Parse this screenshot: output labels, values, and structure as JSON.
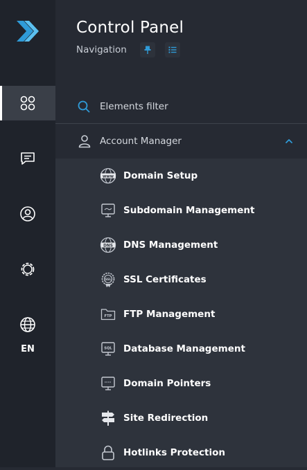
{
  "header": {
    "title": "Control Panel",
    "subtitle": "Navigation"
  },
  "rail": {
    "items": [
      {
        "name": "dashboard",
        "icon": "grid-circles-icon"
      },
      {
        "name": "messages",
        "icon": "chat-icon"
      },
      {
        "name": "account",
        "icon": "user-circle-icon"
      },
      {
        "name": "settings",
        "icon": "gear-icon"
      },
      {
        "name": "language",
        "icon": "globe-icon"
      }
    ],
    "language": "EN"
  },
  "filter": {
    "label": "Elements filter"
  },
  "group": {
    "label": "Account Manager",
    "expanded": true
  },
  "menu": {
    "items": [
      {
        "label": "Domain Setup",
        "icon": "www-icon"
      },
      {
        "label": "Subdomain Management",
        "icon": "monitor-icon"
      },
      {
        "label": "DNS Management",
        "icon": "dns-icon"
      },
      {
        "label": "SSL Certificates",
        "icon": "ssl-badge-icon"
      },
      {
        "label": "FTP Management",
        "icon": "ftp-folder-icon"
      },
      {
        "label": "Database Management",
        "icon": "sql-monitor-icon"
      },
      {
        "label": "Domain Pointers",
        "icon": "pointer-monitor-icon"
      },
      {
        "label": "Site Redirection",
        "icon": "signpost-icon"
      },
      {
        "label": "Hotlinks Protection",
        "icon": "lock-icon"
      }
    ]
  },
  "colors": {
    "accent": "#2f9bd8",
    "rail_bg": "#1f232b",
    "panel_bg": "#262a33",
    "menu_bg": "#2e333c"
  }
}
